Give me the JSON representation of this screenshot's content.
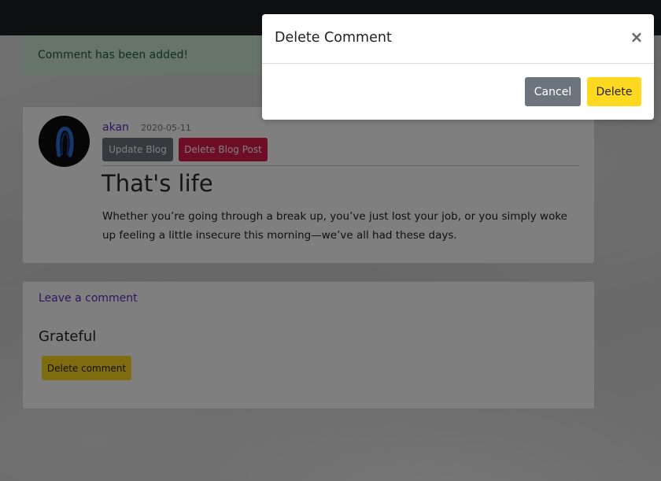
{
  "alert": {
    "message": "Comment has been added!"
  },
  "post": {
    "author": "akan",
    "date": "2020-05-11",
    "update_label": "Update Blog",
    "delete_label": "Delete Blog Post",
    "title": "That's life",
    "body": "Whether you’re going through a break up, you’ve just lost your job, or you simply woke up feeling a little insecure this morning—we’ve all had these days."
  },
  "comments": {
    "leave_comment_label": "Leave a comment",
    "items": [
      {
        "text": "Grateful",
        "delete_label": "Delete comment"
      }
    ]
  },
  "modal": {
    "title": "Delete Comment",
    "close_symbol": "×",
    "cancel_label": "Cancel",
    "confirm_label": "Delete"
  },
  "icons": {
    "avatar": "user-avatar-icon",
    "close": "close-icon"
  },
  "colors": {
    "navbar": "#1f2023",
    "alert_bg": "#cde9d4",
    "link": "#5b2fbf",
    "secondary": "#6c757d",
    "danger": "#dc1c4b",
    "warning": "#ffd91f"
  }
}
